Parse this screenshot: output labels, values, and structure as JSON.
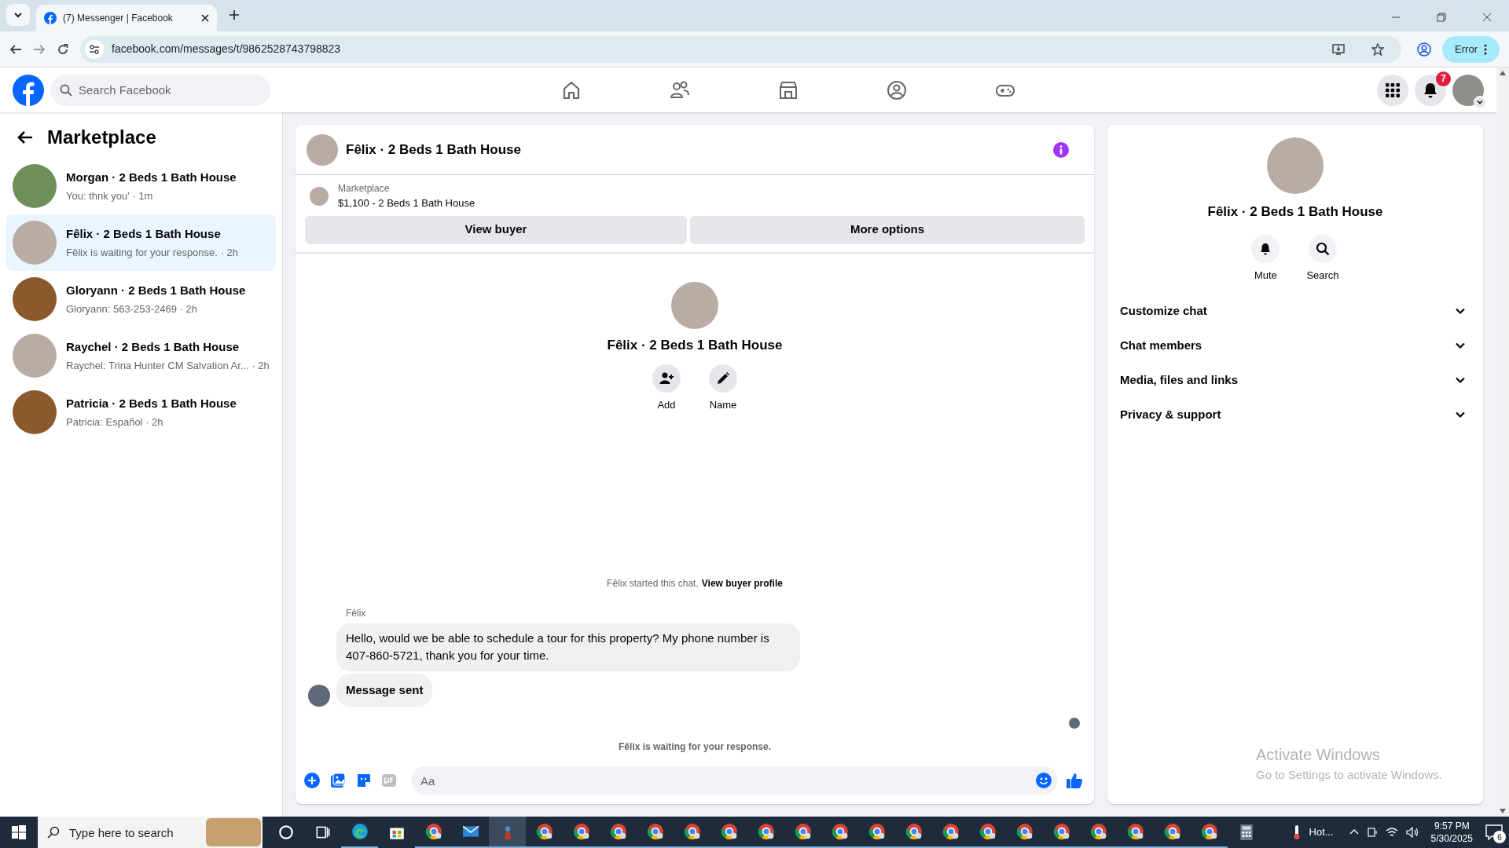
{
  "browser": {
    "tab_title": "(7) Messenger | Facebook",
    "url": "facebook.com/messages/t/9862528743798823",
    "profile_button": "Error"
  },
  "header": {
    "search_placeholder": "Search Facebook",
    "nav": [
      {
        "kind": "home",
        "selected": false
      },
      {
        "kind": "friends",
        "selected": false
      },
      {
        "kind": "marketplace",
        "selected": false
      },
      {
        "kind": "groups",
        "selected": false
      },
      {
        "kind": "gaming",
        "selected": false
      }
    ],
    "notification_count": "7"
  },
  "sidebar": {
    "title": "Marketplace",
    "conversations": [
      {
        "name": "Morgan · 2 Beds 1 Bath House",
        "preview": "You: thnk you' · 1m",
        "selected": false,
        "color": "#6f8f5a"
      },
      {
        "name": "Fêlix · 2 Beds 1 Bath House",
        "preview": "Fêlix is waiting for your response. · 2h",
        "selected": true,
        "color": "#b8aca4"
      },
      {
        "name": "Gloryann · 2 Beds 1 Bath House",
        "preview": "Gloryann: 563-253-2469 · 2h",
        "selected": false,
        "color": "#8a5a2e"
      },
      {
        "name": "Raychel · 2 Beds 1 Bath House",
        "preview": "Raychel: Trina Hunter CM Salvation Ar... · 2h",
        "selected": false,
        "color": "#b8aca4"
      },
      {
        "name": "Patricia · 2 Beds 1 Bath House",
        "preview": "Patricia: Español · 2h",
        "selected": false,
        "color": "#8a5a2e"
      }
    ]
  },
  "chat": {
    "title": "Fêlix · 2 Beds 1 Bath House",
    "listing": {
      "label": "Marketplace",
      "title": "$1,100 - 2 Beds 1 Bath House"
    },
    "buttons": [
      "View buyer",
      "More options"
    ],
    "intro": {
      "title": "Fêlix · 2 Beds 1 Bath House",
      "actions": [
        {
          "kind": "add",
          "label": "Add"
        },
        {
          "kind": "name",
          "label": "Name"
        }
      ]
    },
    "started": {
      "text": "Fêlix started this chat.",
      "link": "View buyer profile"
    },
    "sender": "Fêlix",
    "messages": [
      {
        "kind": "text",
        "text": "Hello, would we be able to schedule a tour for this property? My phone number is 407-860-5721, thank you for your time."
      },
      {
        "kind": "status",
        "text": "Message sent"
      }
    ],
    "waiting": "Fêlix is waiting for your response.",
    "composer": {
      "placeholder": "Aa"
    }
  },
  "details": {
    "title": "Fêlix · 2 Beds 1 Bath House",
    "actions": [
      {
        "kind": "mute",
        "label": "Mute"
      },
      {
        "kind": "search",
        "label": "Search"
      }
    ],
    "sections": [
      {
        "label": "Customize chat",
        "expanded": false
      },
      {
        "label": "Chat members",
        "expanded": false
      },
      {
        "label": "Media, files and links",
        "expanded": false
      },
      {
        "label": "Privacy & support",
        "expanded": false
      }
    ]
  },
  "activation": {
    "title": "Activate Windows",
    "subtitle": "Go to Settings to activate Windows."
  },
  "taskbar": {
    "search_placeholder": "Type here to search",
    "apps": [
      {
        "kind": "circle",
        "selected": false
      },
      {
        "kind": "taskview",
        "selected": false
      },
      {
        "kind": "edge",
        "selected": false
      },
      {
        "kind": "store",
        "selected": false
      },
      {
        "kind": "chrome",
        "selected": false
      },
      {
        "kind": "mail",
        "selected": false
      },
      {
        "kind": "app",
        "selected": true
      },
      {
        "kind": "chrome",
        "selected": false
      },
      {
        "kind": "chrome",
        "selected": false
      },
      {
        "kind": "chrome",
        "selected": false
      },
      {
        "kind": "chrome",
        "selected": false
      },
      {
        "kind": "chrome",
        "selected": false
      },
      {
        "kind": "chrome",
        "selected": false
      },
      {
        "kind": "chrome",
        "selected": false
      },
      {
        "kind": "chrome",
        "selected": false
      },
      {
        "kind": "chrome",
        "selected": false
      },
      {
        "kind": "chrome",
        "selected": false
      },
      {
        "kind": "chrome",
        "selected": false
      },
      {
        "kind": "chrome",
        "selected": false
      },
      {
        "kind": "chrome",
        "selected": false
      },
      {
        "kind": "chrome",
        "selected": false
      },
      {
        "kind": "chrome",
        "selected": false
      },
      {
        "kind": "chrome",
        "selected": false
      },
      {
        "kind": "chrome",
        "selected": false
      },
      {
        "kind": "chrome",
        "selected": false
      },
      {
        "kind": "chrome",
        "selected": false
      },
      {
        "kind": "calculator",
        "selected": false
      }
    ],
    "weather": "Hot...",
    "time": "9:57 PM",
    "date": "5/30/2025",
    "notifications": "6"
  }
}
